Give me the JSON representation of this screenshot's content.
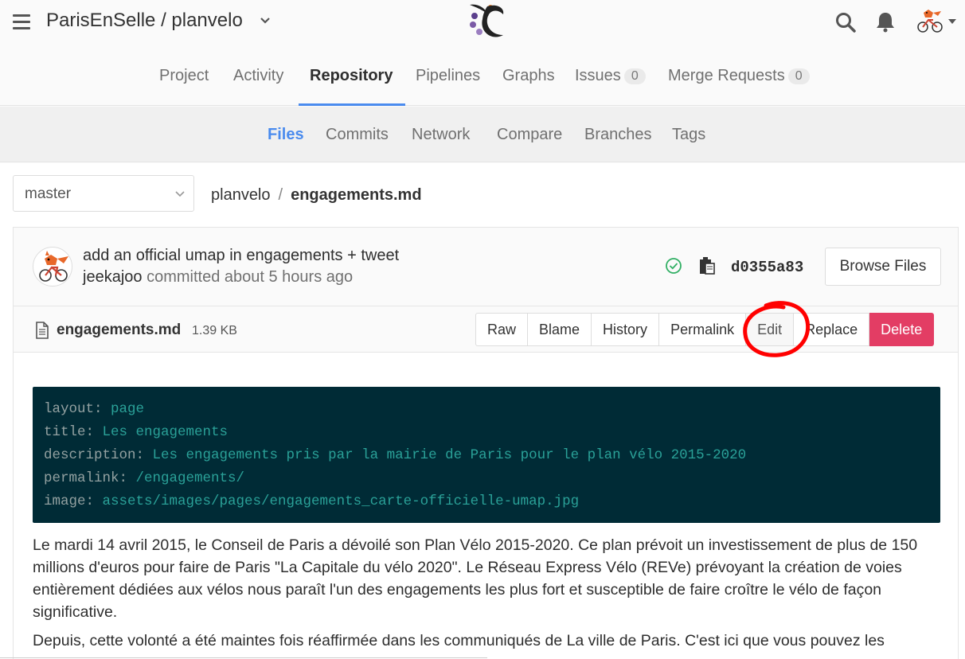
{
  "header": {
    "project_title": "ParisEnSelle / planvelo"
  },
  "nav": {
    "tabs": [
      {
        "label": "Project"
      },
      {
        "label": "Activity"
      },
      {
        "label": "Repository"
      },
      {
        "label": "Pipelines"
      },
      {
        "label": "Graphs"
      },
      {
        "label": "Issues",
        "count": "0"
      },
      {
        "label": "Merge Requests",
        "count": "0"
      }
    ],
    "active": "Repository"
  },
  "subnav": {
    "tabs": [
      {
        "label": "Files"
      },
      {
        "label": "Commits"
      },
      {
        "label": "Network"
      },
      {
        "label": "Compare"
      },
      {
        "label": "Branches"
      },
      {
        "label": "Tags"
      }
    ],
    "active": "Files"
  },
  "branch": {
    "selected": "master"
  },
  "breadcrumb": {
    "repo": "planvelo",
    "separator": "/",
    "file": "engagements.md"
  },
  "commit": {
    "message": "add an official umap in engagements + tweet",
    "author": "jeekajoo",
    "meta": "committed about 5 hours ago",
    "sha": "d0355a83",
    "browse_label": "Browse Files",
    "status_color": "#31af64"
  },
  "file": {
    "name": "engagements.md",
    "size": "1.39 KB",
    "buttons": {
      "raw": "Raw",
      "blame": "Blame",
      "history": "History",
      "permalink": "Permalink",
      "edit": "Edit",
      "replace": "Replace",
      "delete": "Delete"
    }
  },
  "frontmatter": [
    {
      "key": "layout:",
      "value": "page"
    },
    {
      "key": "title:",
      "value": "Les engagements"
    },
    {
      "key": "description:",
      "value": "Les engagements pris par la mairie de Paris pour le plan vélo 2015-2020"
    },
    {
      "key": "permalink:",
      "value": "/engagements/"
    },
    {
      "key": "image:",
      "value": "assets/images/pages/engagements_carte-officielle-umap.jpg"
    }
  ],
  "body": {
    "para1": "Le mardi 14 avril 2015, le Conseil de Paris a dévoilé son Plan Vélo 2015-2020. Ce plan prévoit un investissement de plus de 150 millions d'euros pour faire de Paris \"La Capitale du vélo 2020\". Le Réseau Express Vélo (REVe) prévoyant la création de voies entièrement dédiées aux vélos nous paraît l'un des engagements les plus fort et susceptible de faire croître le vélo de façon significative.",
    "para2": "Depuis, cette volonté a été maintes fois réaffirmée dans les communiqués de La ville de Paris. C'est ici que vous pouvez les"
  },
  "colors": {
    "accent": "#4a8bee",
    "delete": "#e33d64",
    "annotation": "#ff0000",
    "code_bg": "#002b36"
  }
}
